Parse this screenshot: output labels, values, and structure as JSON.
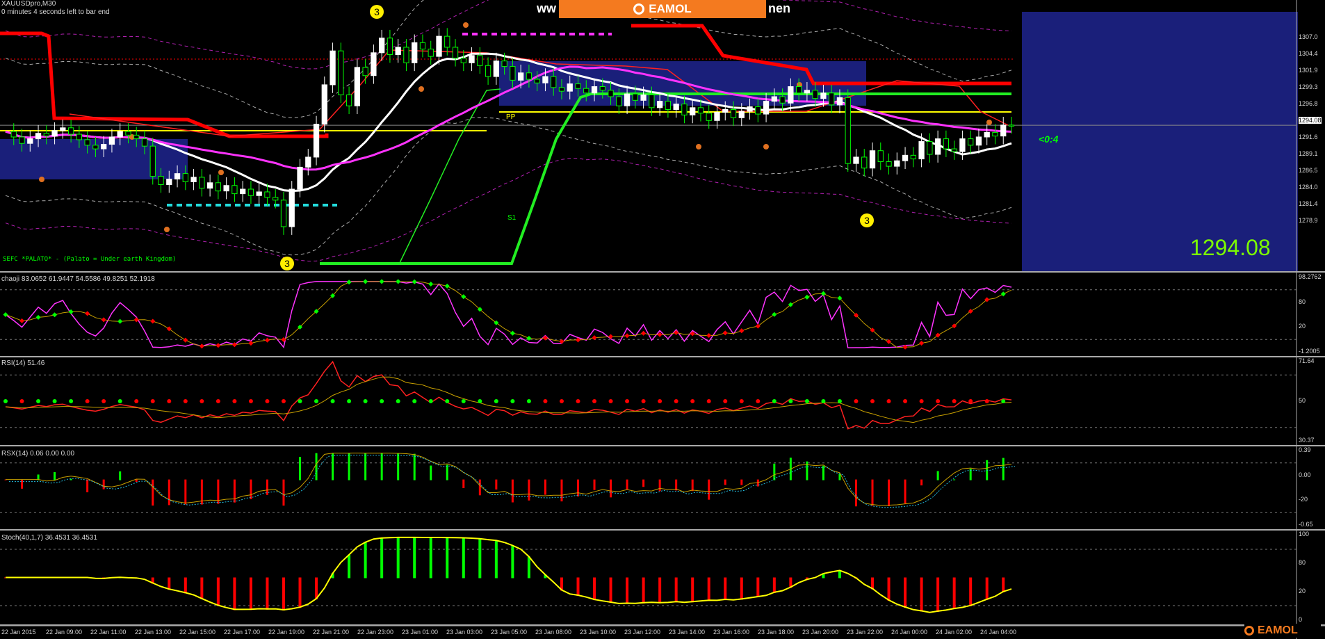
{
  "header": {
    "symbol_line": "XAUUSDpro,M30",
    "timer_line": "0 minutes 4 seconds left to bar end",
    "site_prefix": "ww",
    "site_suffix": "nen",
    "brand": "EAMOL"
  },
  "main_panel": {
    "pp_label": "PP",
    "s1_label": "S1",
    "signal_label": "<0:4",
    "footer_text": "SEFC *PALATO* - (Palato = Under earth Kingdom)",
    "wave_labels": [
      "3",
      "3",
      "3"
    ],
    "current_price": "1294.08",
    "price_axis": [
      "1307.0",
      "1304.4",
      "1301.9",
      "1299.3",
      "1296.8",
      "1294.08",
      "1291.6",
      "1289.1",
      "1286.5",
      "1284.0",
      "1281.4",
      "1278.9"
    ]
  },
  "chaoji_panel": {
    "title": "chaoji 83.0652 61.9447 54.5586 49.8251 52.1918",
    "axis": [
      "98.2762",
      "80",
      "20",
      "-1.2005"
    ]
  },
  "rsi_panel": {
    "title": "RSI(14) 51.46",
    "axis": [
      "71.64",
      "50",
      "30.37"
    ]
  },
  "rsx_panel": {
    "title": "RSX(14) 0.06 0.00 0.00",
    "axis": [
      "0.39",
      "0.00",
      "-20",
      "-0.65"
    ]
  },
  "stoch_panel": {
    "title": "Stoch(40,1,7) 36.4531 36.4531",
    "axis": [
      "100",
      "80",
      "20",
      "0"
    ]
  },
  "time_axis": [
    "22 Jan 2015",
    "22 Jan 09:00",
    "22 Jan 11:00",
    "22 Jan 13:00",
    "22 Jan 15:00",
    "22 Jan 17:00",
    "22 Jan 19:00",
    "22 Jan 21:00",
    "22 Jan 23:00",
    "23 Jan 01:00",
    "23 Jan 03:00",
    "23 Jan 05:00",
    "23 Jan 08:00",
    "23 Jan 10:00",
    "23 Jan 12:00",
    "23 Jan 14:00",
    "23 Jan 16:00",
    "23 Jan 18:00",
    "23 Jan 20:00",
    "23 Jan 22:00",
    "24 Jan 00:00",
    "24 Jan 02:00",
    "24 Jan 04:00"
  ],
  "colors": {
    "up": "#00ff00",
    "down": "#ff0000",
    "ma_white": "#ffffff",
    "ma_magenta": "#ff33ff",
    "resistance": "#ff0000",
    "pivot": "#ffff00",
    "zone": "#1a1f7a",
    "accent": "#f47a1f"
  },
  "chart_data": {
    "type": "candlestick",
    "symbol": "XAUUSDpro",
    "timeframe": "M30",
    "ylim": [
      1278.9,
      1307.0
    ],
    "close": [
      1293.4,
      1292.8,
      1292.1,
      1292.6,
      1293.2,
      1292.9,
      1293.5,
      1293.8,
      1293.1,
      1292.5,
      1291.9,
      1291.5,
      1292.0,
      1292.8,
      1293.4,
      1293.0,
      1292.6,
      1291.8,
      1288.5,
      1287.6,
      1288.2,
      1288.8,
      1287.9,
      1288.4,
      1287.2,
      1287.8,
      1286.9,
      1287.5,
      1286.6,
      1287.1,
      1286.4,
      1286.8,
      1286.2,
      1285.9,
      1283.0,
      1287.1,
      1289.5,
      1290.6,
      1294.2,
      1298.5,
      1302.2,
      1297.4,
      1296.2,
      1300.4,
      1299.5,
      1302.0,
      1303.6,
      1301.8,
      1302.6,
      1300.9,
      1303.1,
      1302.4,
      1301.6,
      1303.8,
      1302.6,
      1301.4,
      1300.9,
      1301.7,
      1300.6,
      1299.4,
      1301.1,
      1300.5,
      1299.0,
      1299.8,
      1299.1,
      1298.7,
      1299.4,
      1298.2,
      1297.8,
      1298.6,
      1298.1,
      1297.6,
      1298.3,
      1297.9,
      1297.2,
      1296.2,
      1297.5,
      1296.8,
      1297.4,
      1296.0,
      1296.7,
      1295.8,
      1296.4,
      1295.2,
      1296.0,
      1295.4,
      1294.6,
      1295.5,
      1295.8,
      1294.9,
      1295.6,
      1296.1,
      1295.3,
      1296.7,
      1297.2,
      1296.5,
      1298.3,
      1297.6,
      1297.9,
      1297.0,
      1297.6,
      1296.3,
      1297.1,
      1289.9,
      1290.6,
      1289.4,
      1291.3,
      1290.1,
      1289.6,
      1290.2,
      1290.8,
      1290.4,
      1292.3,
      1290.9,
      1292.6,
      1291.5,
      1291.2,
      1292.6,
      1291.9,
      1292.8,
      1293.3,
      1292.9,
      1294.1,
      1294.08
    ]
  }
}
